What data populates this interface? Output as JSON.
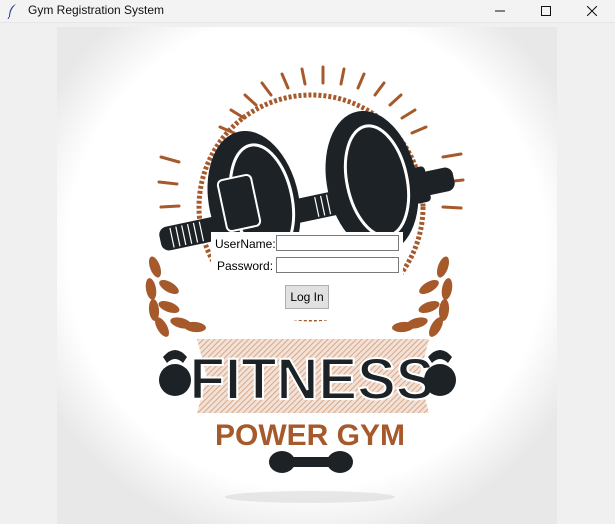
{
  "window": {
    "title": "Gym Registration System",
    "icon": "feather-icon"
  },
  "logo": {
    "headline": "FITNESS",
    "subline": "POWER GYM",
    "colors": {
      "dark": "#1d2226",
      "accent": "#a65a2c",
      "ribbon": "#e9c8b2"
    }
  },
  "login": {
    "username_label": "UserName:",
    "password_label": "Password:",
    "username_value": "",
    "password_value": "",
    "button_label": "Log In"
  }
}
